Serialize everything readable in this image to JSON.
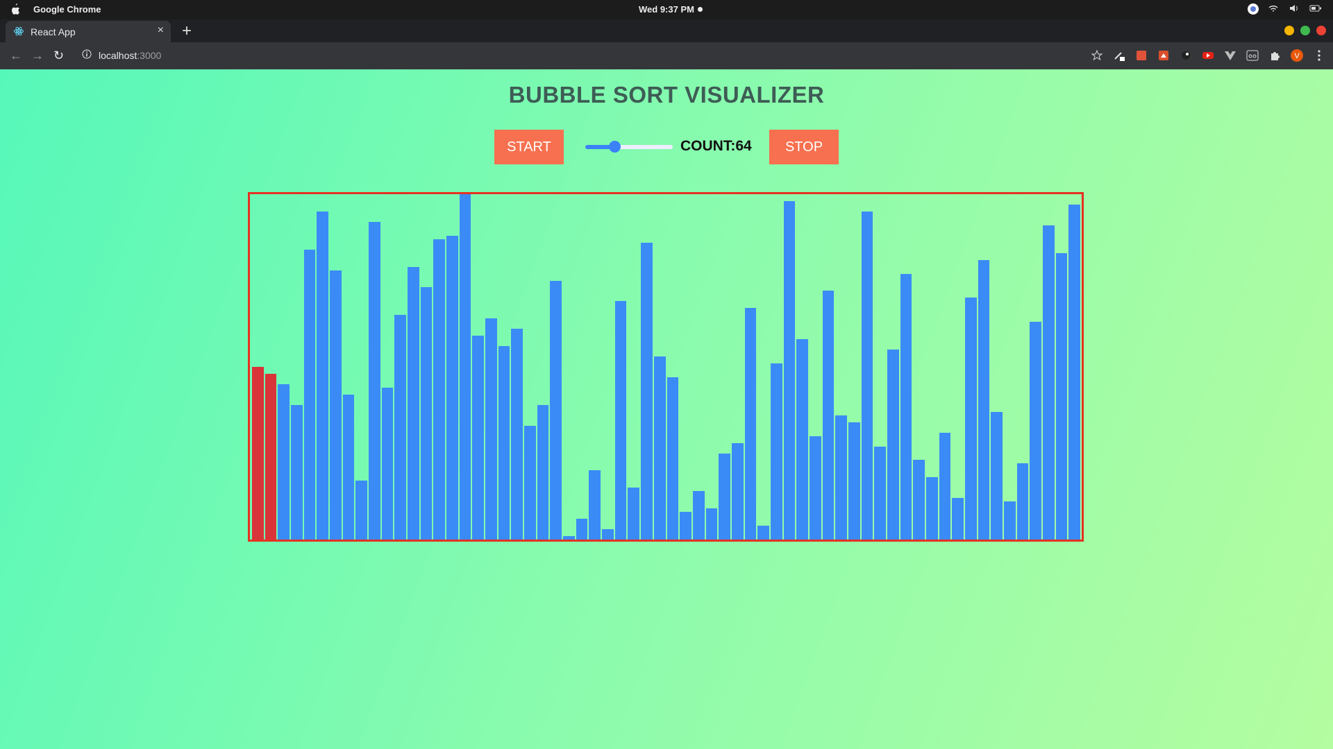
{
  "os": {
    "app_name": "Google Chrome",
    "clock": "Wed  9:37 PM"
  },
  "browser": {
    "tab_title": "React App",
    "url_host": "localhost",
    "url_port": ":3000"
  },
  "page": {
    "title": "BUBBLE SORT VISUALIZER",
    "start_label": "START",
    "stop_label": "STOP",
    "count_label": "COUNT:",
    "count_value": "64",
    "speed_fraction": 0.33,
    "bar_color": "#3b8bf6",
    "active_color": "#d9343a",
    "active_indices": [
      0,
      1
    ]
  },
  "chart_data": {
    "type": "bar",
    "values": [
      50,
      48,
      45,
      39,
      84,
      95,
      78,
      42,
      17,
      92,
      44,
      65,
      79,
      73,
      87,
      88,
      100,
      59,
      64,
      56,
      61,
      33,
      39,
      75,
      1,
      6,
      20,
      3,
      69,
      15,
      86,
      53,
      47,
      8,
      14,
      9,
      25,
      28,
      67,
      4,
      51,
      98,
      58,
      30,
      72,
      36,
      34,
      95,
      27,
      55,
      77,
      23,
      18,
      31,
      12,
      70,
      81,
      37,
      11,
      22,
      63,
      91,
      83,
      97
    ]
  }
}
